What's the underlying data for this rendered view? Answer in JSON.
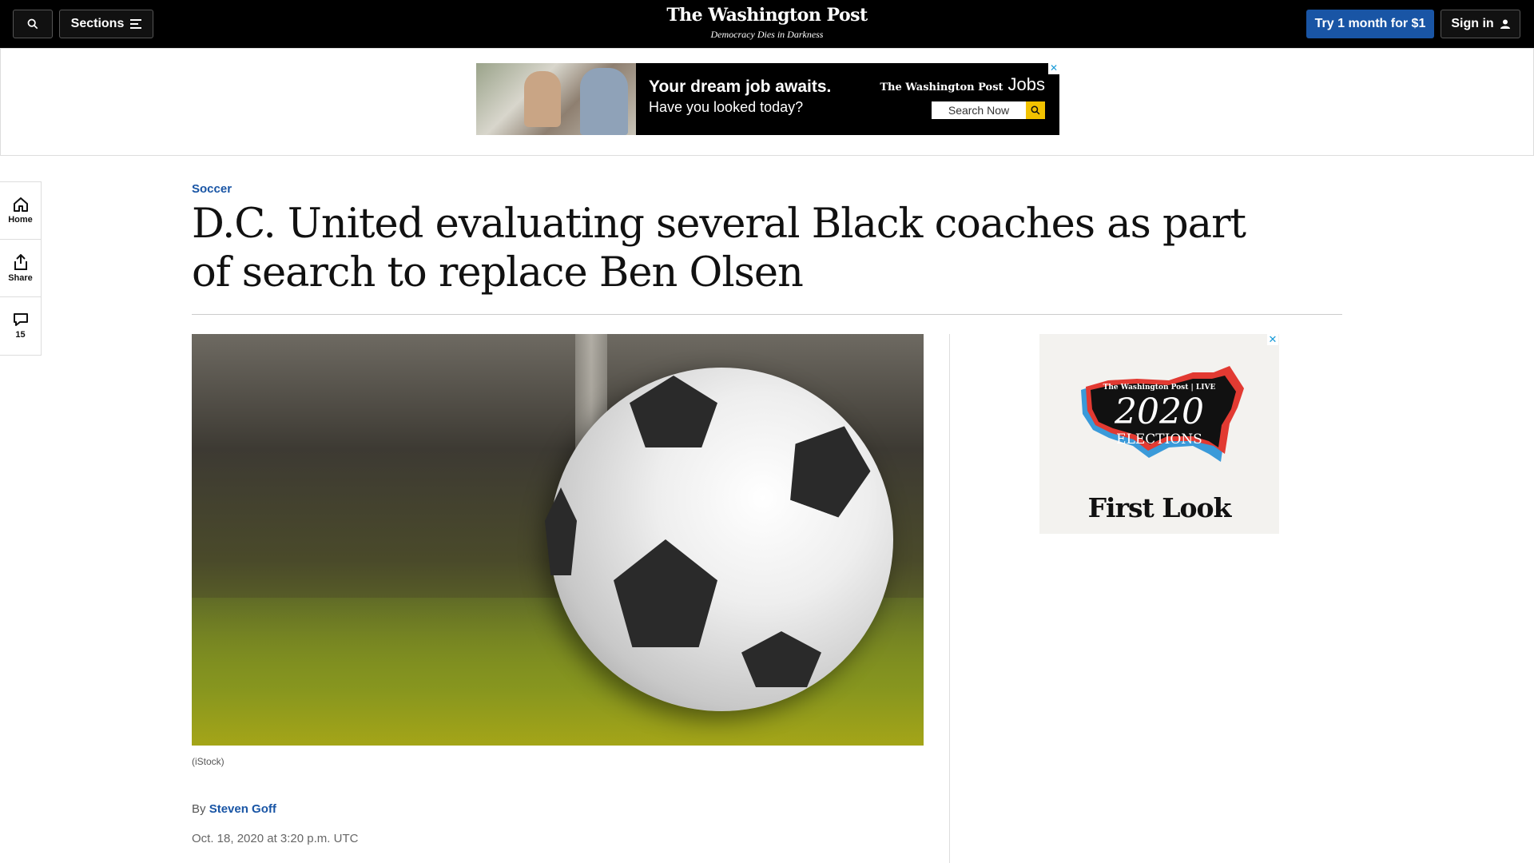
{
  "header": {
    "sections_label": "Sections",
    "logo": "The Washington Post",
    "tagline": "Democracy Dies in Darkness",
    "subscribe_label": "Try 1 month for $1",
    "signin_label": "Sign in"
  },
  "top_ad": {
    "headline": "Your dream job awaits.",
    "subline": "Have you looked today?",
    "brand": "The Washington Post",
    "brand_suffix": "Jobs",
    "search_label": "Search Now",
    "close_glyph": "✕"
  },
  "rail": {
    "home_label": "Home",
    "share_label": "Share",
    "comments_count": "15"
  },
  "article": {
    "kicker": "Soccer",
    "headline": "D.C. United evaluating several Black coaches as part of search to replace Ben Olsen",
    "image_caption": "(iStock)",
    "byline_prefix": "By",
    "author": "Steven Goff",
    "date": "Oct. 18, 2020 at 3:20 p.m. UTC"
  },
  "side_ad": {
    "brand": "The Washington Post | LIVE",
    "year": "2020",
    "title": "ELECTIONS",
    "subtitle": "First Look",
    "close_glyph": "✕"
  },
  "colors": {
    "accent": "#1955a5",
    "ad_close": "#1a9bd7"
  }
}
